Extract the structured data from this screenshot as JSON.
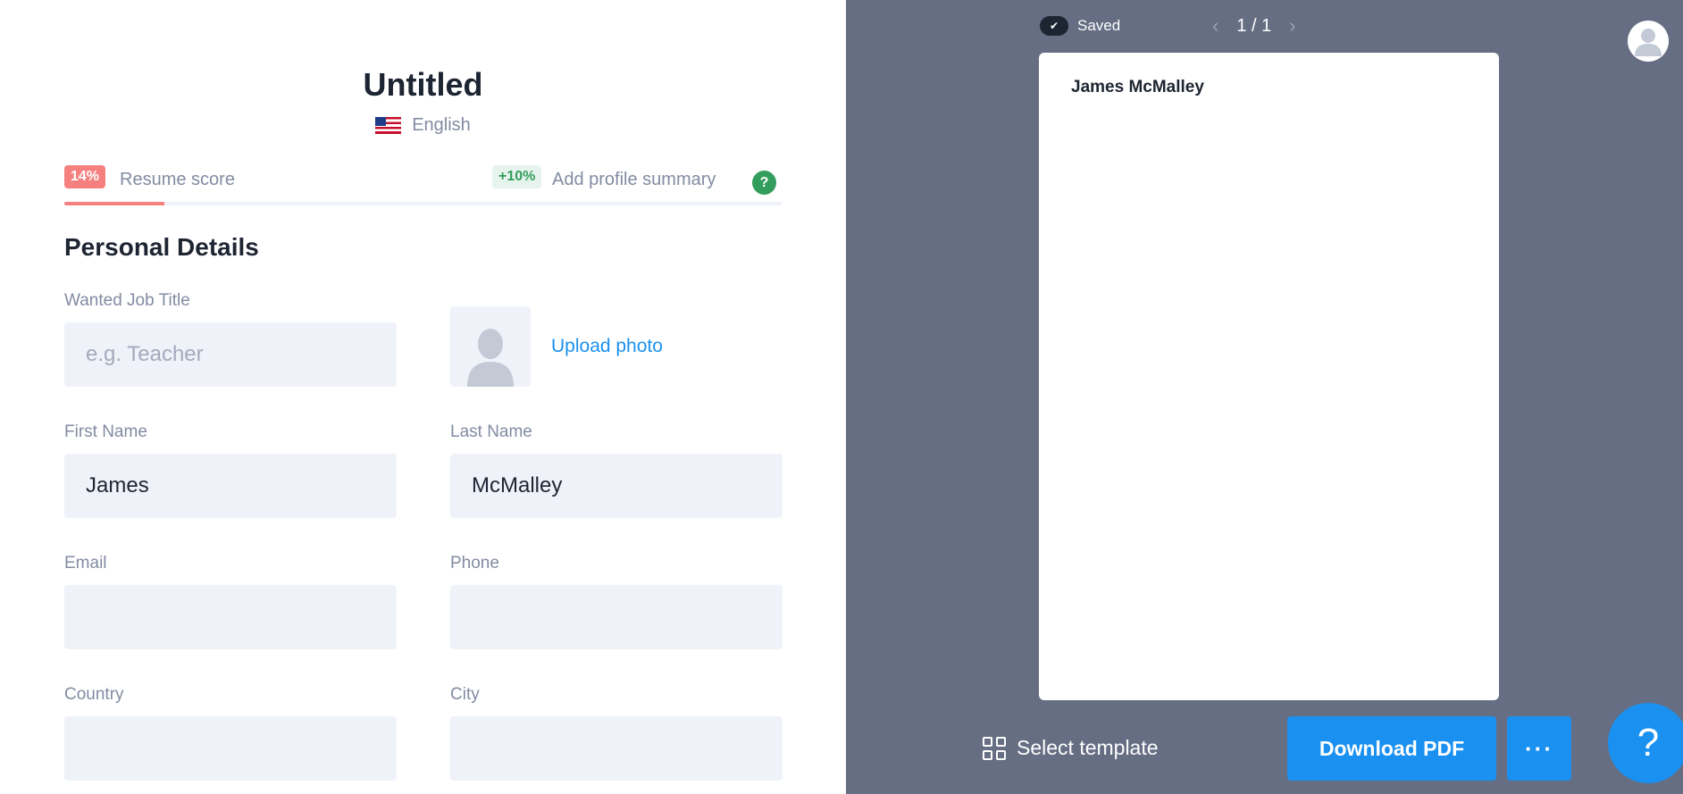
{
  "document": {
    "title": "Untitled",
    "language": "English",
    "language_flag": "us-flag-icon"
  },
  "resume_score": {
    "score_badge": "14%",
    "score_label": "Resume score",
    "score_value": 0.14,
    "bonus_badge": "+10%",
    "bonus_label": "Add profile summary",
    "help_label": "?"
  },
  "section": {
    "title": "Personal Details"
  },
  "fields": {
    "job_title": {
      "label": "Wanted Job Title",
      "value": "",
      "placeholder": "e.g. Teacher"
    },
    "first_name": {
      "label": "First Name",
      "value": "James",
      "placeholder": ""
    },
    "last_name": {
      "label": "Last Name",
      "value": "McMalley",
      "placeholder": ""
    },
    "email": {
      "label": "Email",
      "value": "",
      "placeholder": ""
    },
    "phone": {
      "label": "Phone",
      "value": "",
      "placeholder": ""
    },
    "country": {
      "label": "Country",
      "value": "",
      "placeholder": ""
    },
    "city": {
      "label": "City",
      "value": "",
      "placeholder": ""
    }
  },
  "photo": {
    "upload_label": "Upload photo",
    "icon": "person-silhouette-icon"
  },
  "preview": {
    "saved_label": "Saved",
    "page_indicator": "1 / 1",
    "prev_icon": "chevron-left-icon",
    "next_icon": "chevron-right-icon",
    "sheet_name": "James McMalley",
    "select_template_label": "Select template",
    "download_label": "Download PDF",
    "more_label": "···",
    "help_fab_label": "?"
  },
  "colors": {
    "accent": "#1a91f0",
    "score_red": "#f68080",
    "score_green": "#339d5d",
    "preview_bg": "#656e83",
    "input_bg": "#eff2f9"
  }
}
